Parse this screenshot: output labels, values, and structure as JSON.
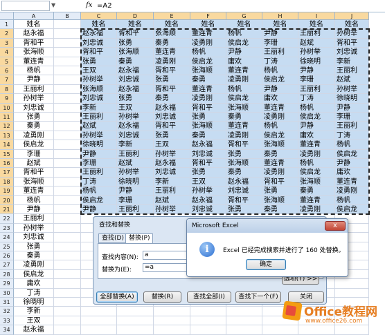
{
  "formula_bar": {
    "name_box": "",
    "fx": "fx",
    "formula": "=A2"
  },
  "columns": [
    "A",
    "B",
    "C",
    "D",
    "E",
    "F",
    "G",
    "H",
    "I",
    "J"
  ],
  "rows": [
    "1",
    "2",
    "3",
    "4",
    "5",
    "6",
    "7",
    "8",
    "9",
    "10",
    "11",
    "12",
    "13",
    "14",
    "15",
    "16",
    "17",
    "18",
    "19",
    "20",
    "21",
    "22",
    "23",
    "24",
    "25",
    "26",
    "27",
    "28",
    "29",
    "30",
    "31",
    "32",
    "33",
    "34"
  ],
  "col_a": [
    "姓名",
    "赵永福",
    "胥和平",
    "张海顺",
    "董连青",
    "杨帆",
    "尹静",
    "王丽利",
    "孙树举",
    "刘忠诚",
    "张勇",
    "秦勇",
    "凌勇刚",
    "侯启龙",
    "李珊",
    "赵斌",
    "胥和平",
    "张海顺",
    "董连青",
    "杨帆",
    "尹静",
    "王丽利",
    "孙树举",
    "刘忠诚",
    "张勇",
    "秦勇",
    "凌勇刚",
    "侯启龙",
    "庸欢",
    "丁涛",
    "徐晓明",
    "李新",
    "王双",
    "赵永福"
  ],
  "grid_header": [
    "姓名",
    "姓名",
    "姓名",
    "姓名",
    "姓名",
    "姓名",
    "姓名",
    "姓名"
  ],
  "grid_rows": [
    [
      "赵永福",
      "胥和平",
      "张海顺",
      "董连青",
      "杨帆",
      "尹静",
      "王丽利",
      "孙树举"
    ],
    [
      "刘忠诚",
      "张勇",
      "秦勇",
      "凌勇刚",
      "侯启龙",
      "李珊",
      "赵斌",
      "胥和平"
    ],
    [
      "胥和平",
      "张海顺",
      "董连青",
      "杨帆",
      "尹静",
      "王丽利",
      "孙树举",
      "刘忠诚"
    ],
    [
      "张勇",
      "秦勇",
      "凌勇刚",
      "侯启龙",
      "庸欢",
      "丁涛",
      "徐晓明",
      "李新"
    ],
    [
      "王双",
      "赵永福",
      "胥和平",
      "张海顺",
      "董连青",
      "杨帆",
      "尹静",
      "王丽利"
    ],
    [
      "孙树举",
      "刘忠诚",
      "张勇",
      "秦勇",
      "凌勇刚",
      "侯启龙",
      "李珊",
      "赵斌"
    ],
    [
      "张海顺",
      "赵永福",
      "胥和平",
      "董连青",
      "杨帆",
      "尹静",
      "王丽利",
      "孙树举"
    ],
    [
      "刘忠诚",
      "张勇",
      "秦勇",
      "凌勇刚",
      "侯启龙",
      "庸欢",
      "丁涛",
      "徐晓明"
    ],
    [
      "李新",
      "王双",
      "赵永福",
      "胥和平",
      "张海顺",
      "董连青",
      "杨帆",
      "尹静"
    ],
    [
      "王丽利",
      "孙树举",
      "刘忠诚",
      "张勇",
      "秦勇",
      "凌勇刚",
      "侯启龙",
      "李珊"
    ],
    [
      "赵斌",
      "赵永福",
      "胥和平",
      "张海顺",
      "董连青",
      "杨帆",
      "尹静",
      "王丽利"
    ],
    [
      "孙树举",
      "刘忠诚",
      "张勇",
      "秦勇",
      "凌勇刚",
      "侯启龙",
      "庸欢",
      "丁涛"
    ],
    [
      "徐晓明",
      "李新",
      "王双",
      "赵永福",
      "胥和平",
      "张海顺",
      "董连青",
      "杨帆"
    ],
    [
      "尹静",
      "王丽利",
      "孙树举",
      "刘忠诚",
      "张勇",
      "秦勇",
      "凌勇刚",
      "侯启龙"
    ],
    [
      "李珊",
      "赵斌",
      "赵永福",
      "胥和平",
      "张海顺",
      "董连青",
      "杨帆",
      "尹静"
    ],
    [
      "王丽利",
      "孙树举",
      "刘忠诚",
      "张勇",
      "秦勇",
      "凌勇刚",
      "侯启龙",
      "庸欢"
    ],
    [
      "丁涛",
      "徐晓明",
      "李新",
      "王双",
      "赵永福",
      "胥和平",
      "张海顺",
      "董连青"
    ],
    [
      "杨帆",
      "尹静",
      "王丽利",
      "孙树举",
      "刘忠诚",
      "张勇",
      "秦勇",
      "凌勇刚"
    ],
    [
      "侯启龙",
      "李珊",
      "赵斌",
      "赵永福",
      "胥和平",
      "张海顺",
      "董连青",
      "杨帆"
    ],
    [
      "尹静",
      "王丽利",
      "孙树举",
      "刘忠诚",
      "张勇",
      "秦勇",
      "凌勇刚",
      "侯启龙"
    ]
  ],
  "replace_dialog": {
    "title": "查找和替换",
    "tab_find": "查找(D)",
    "tab_replace": "替换(P)",
    "find_label": "查找内容(N):",
    "find_value": "a",
    "replace_label": "替换为(E):",
    "replace_value": "=a",
    "options": "选项(T) >>",
    "btn_replace_all": "全部替换(A)",
    "btn_replace": "替换(R)",
    "btn_find_all": "查找全部(I)",
    "btn_find_next": "查找下一个(F)",
    "btn_close": "关闭"
  },
  "message_dialog": {
    "title": "Microsoft Excel",
    "text": "Excel 已经完成搜索并进行了 160 处替换。",
    "ok": "确定",
    "close": "x"
  },
  "watermark": {
    "name": "Office教程网",
    "url": "www.office26.com"
  }
}
